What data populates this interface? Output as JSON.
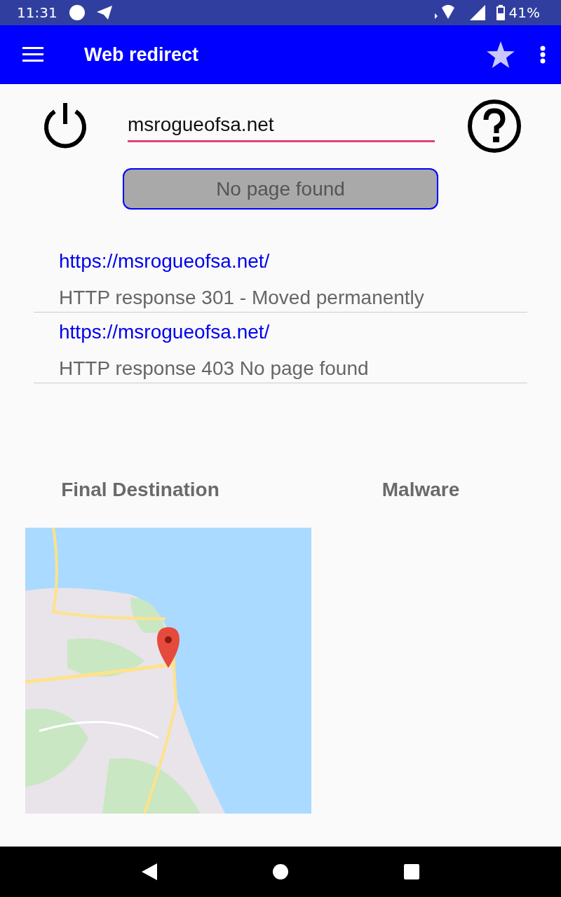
{
  "status_bar": {
    "time": "11:31",
    "battery": "41%"
  },
  "toolbar": {
    "title": "Web redirect"
  },
  "url_field": {
    "value": "msrogueofsa.net"
  },
  "status_button": {
    "label": "No page found"
  },
  "redirects": [
    {
      "url": "https://msrogueofsa.net/",
      "response": "HTTP response 301 - Moved permanently"
    },
    {
      "url": "https://msrogueofsa.net/",
      "response": "HTTP response 403 No page found"
    }
  ],
  "sections": [
    {
      "title": "Final Destination"
    },
    {
      "title": "Malware"
    }
  ]
}
